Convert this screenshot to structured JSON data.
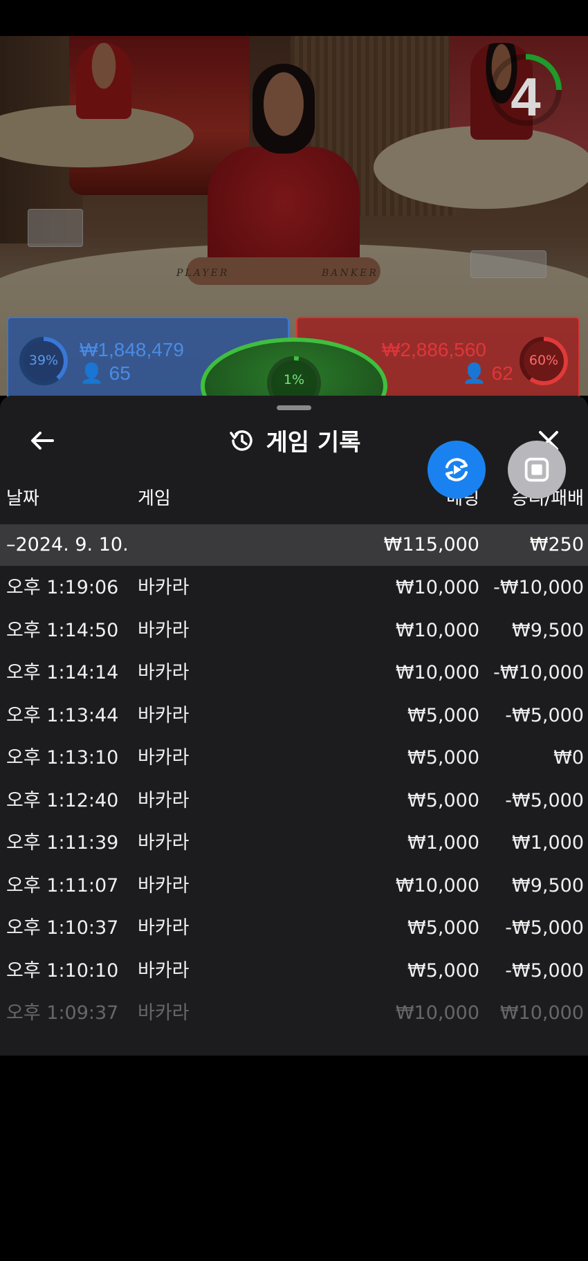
{
  "live": {
    "countdown": "4",
    "felt_player": "PLAYER",
    "felt_banker": "BANKER",
    "player": {
      "percent": "39%",
      "amount": "₩1,848,479",
      "players": "65",
      "fill": 0.39
    },
    "banker": {
      "percent": "60%",
      "amount": "₩2,886,560",
      "players": "62",
      "fill": 0.6
    },
    "tie": {
      "percent": "1%",
      "fill": 0.01
    }
  },
  "sheet": {
    "title": "게임 기록",
    "icons": {
      "back": "back-arrow-icon",
      "history": "history-icon",
      "close": "close-icon",
      "replay": "replay-icon",
      "stop": "stop-icon"
    },
    "columns": {
      "date": "날짜",
      "game": "게임",
      "bet": "베팅",
      "win_loss": "승리/패배"
    },
    "day": {
      "label": "–2024. 9. 10.",
      "bet_total": "₩115,000",
      "wl_total": "₩250"
    },
    "rows": [
      {
        "time": "오후 1:19:06",
        "game": "바카라",
        "bet": "₩10,000",
        "wl": "-₩10,000"
      },
      {
        "time": "오후 1:14:50",
        "game": "바카라",
        "bet": "₩10,000",
        "wl": "₩9,500"
      },
      {
        "time": "오후 1:14:14",
        "game": "바카라",
        "bet": "₩10,000",
        "wl": "-₩10,000"
      },
      {
        "time": "오후 1:13:44",
        "game": "바카라",
        "bet": "₩5,000",
        "wl": "-₩5,000"
      },
      {
        "time": "오후 1:13:10",
        "game": "바카라",
        "bet": "₩5,000",
        "wl": "₩0"
      },
      {
        "time": "오후 1:12:40",
        "game": "바카라",
        "bet": "₩5,000",
        "wl": "-₩5,000"
      },
      {
        "time": "오후 1:11:39",
        "game": "바카라",
        "bet": "₩1,000",
        "wl": "₩1,000"
      },
      {
        "time": "오후 1:11:07",
        "game": "바카라",
        "bet": "₩10,000",
        "wl": "₩9,500"
      },
      {
        "time": "오후 1:10:37",
        "game": "바카라",
        "bet": "₩5,000",
        "wl": "-₩5,000"
      },
      {
        "time": "오후 1:10:10",
        "game": "바카라",
        "bet": "₩5,000",
        "wl": "-₩5,000"
      },
      {
        "time": "오후 1:09:37",
        "game": "바카라",
        "bet": "₩10,000",
        "wl": "₩10,000"
      }
    ]
  },
  "colors": {
    "player": "#3a78d6",
    "banker": "#e03a3a",
    "tie": "#3fbf3f",
    "accent": "#1a82f0",
    "sheet_bg": "#1c1c1e"
  }
}
